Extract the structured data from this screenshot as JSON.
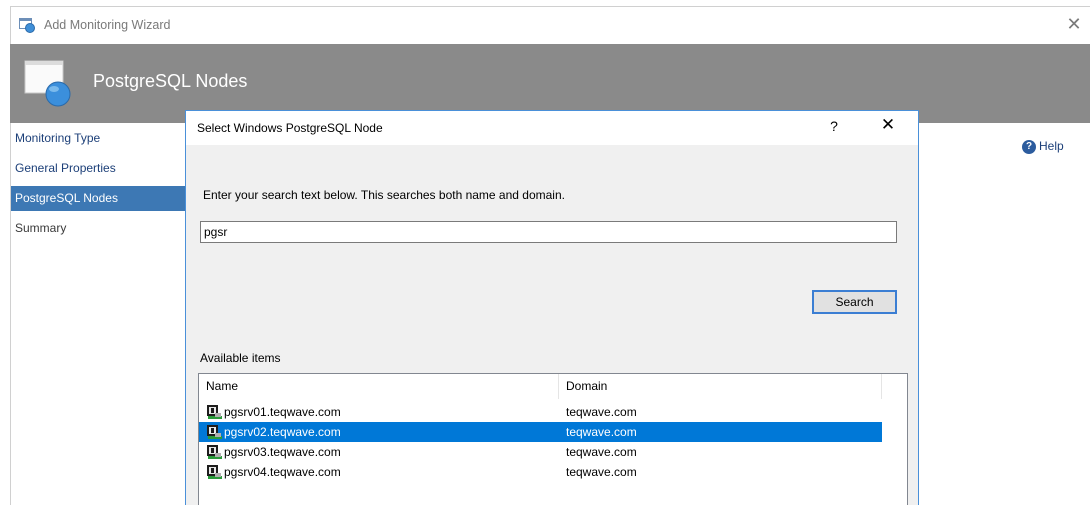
{
  "window": {
    "title": "Add Monitoring Wizard",
    "close_glyph": "✕",
    "icon": "wizard-window-icon"
  },
  "banner": {
    "title": "PostgreSQL Nodes",
    "icon": "monitor-globe-icon",
    "background": "#8a8a8a"
  },
  "nav": {
    "items": [
      {
        "label": "Monitoring Type",
        "state": "link"
      },
      {
        "label": "General Properties",
        "state": "link"
      },
      {
        "label": "PostgreSQL Nodes",
        "state": "active"
      },
      {
        "label": "Summary",
        "state": "disabled"
      }
    ],
    "active_color": "#3d78b4"
  },
  "help": {
    "label": "Help",
    "icon_glyph": "?",
    "icon": "help-icon"
  },
  "dialog": {
    "title": "Select Windows PostgreSQL Node",
    "help_glyph": "?",
    "close_glyph": "✕",
    "instructions": "Enter your search text below.  This searches both name and domain.",
    "search": {
      "value": "pgsr",
      "button_label": "Search"
    },
    "available_label": "Available items",
    "list": {
      "columns": [
        "Name",
        "Domain"
      ],
      "rows": [
        {
          "name": "pgsrv01.teqwave.com",
          "domain": "teqwave.com",
          "selected": false
        },
        {
          "name": "pgsrv02.teqwave.com",
          "domain": "teqwave.com",
          "selected": true
        },
        {
          "name": "pgsrv03.teqwave.com",
          "domain": "teqwave.com",
          "selected": false
        },
        {
          "name": "pgsrv04.teqwave.com",
          "domain": "teqwave.com",
          "selected": false
        }
      ],
      "row_icon": "server-icon",
      "selection_color": "#0078d7"
    }
  }
}
